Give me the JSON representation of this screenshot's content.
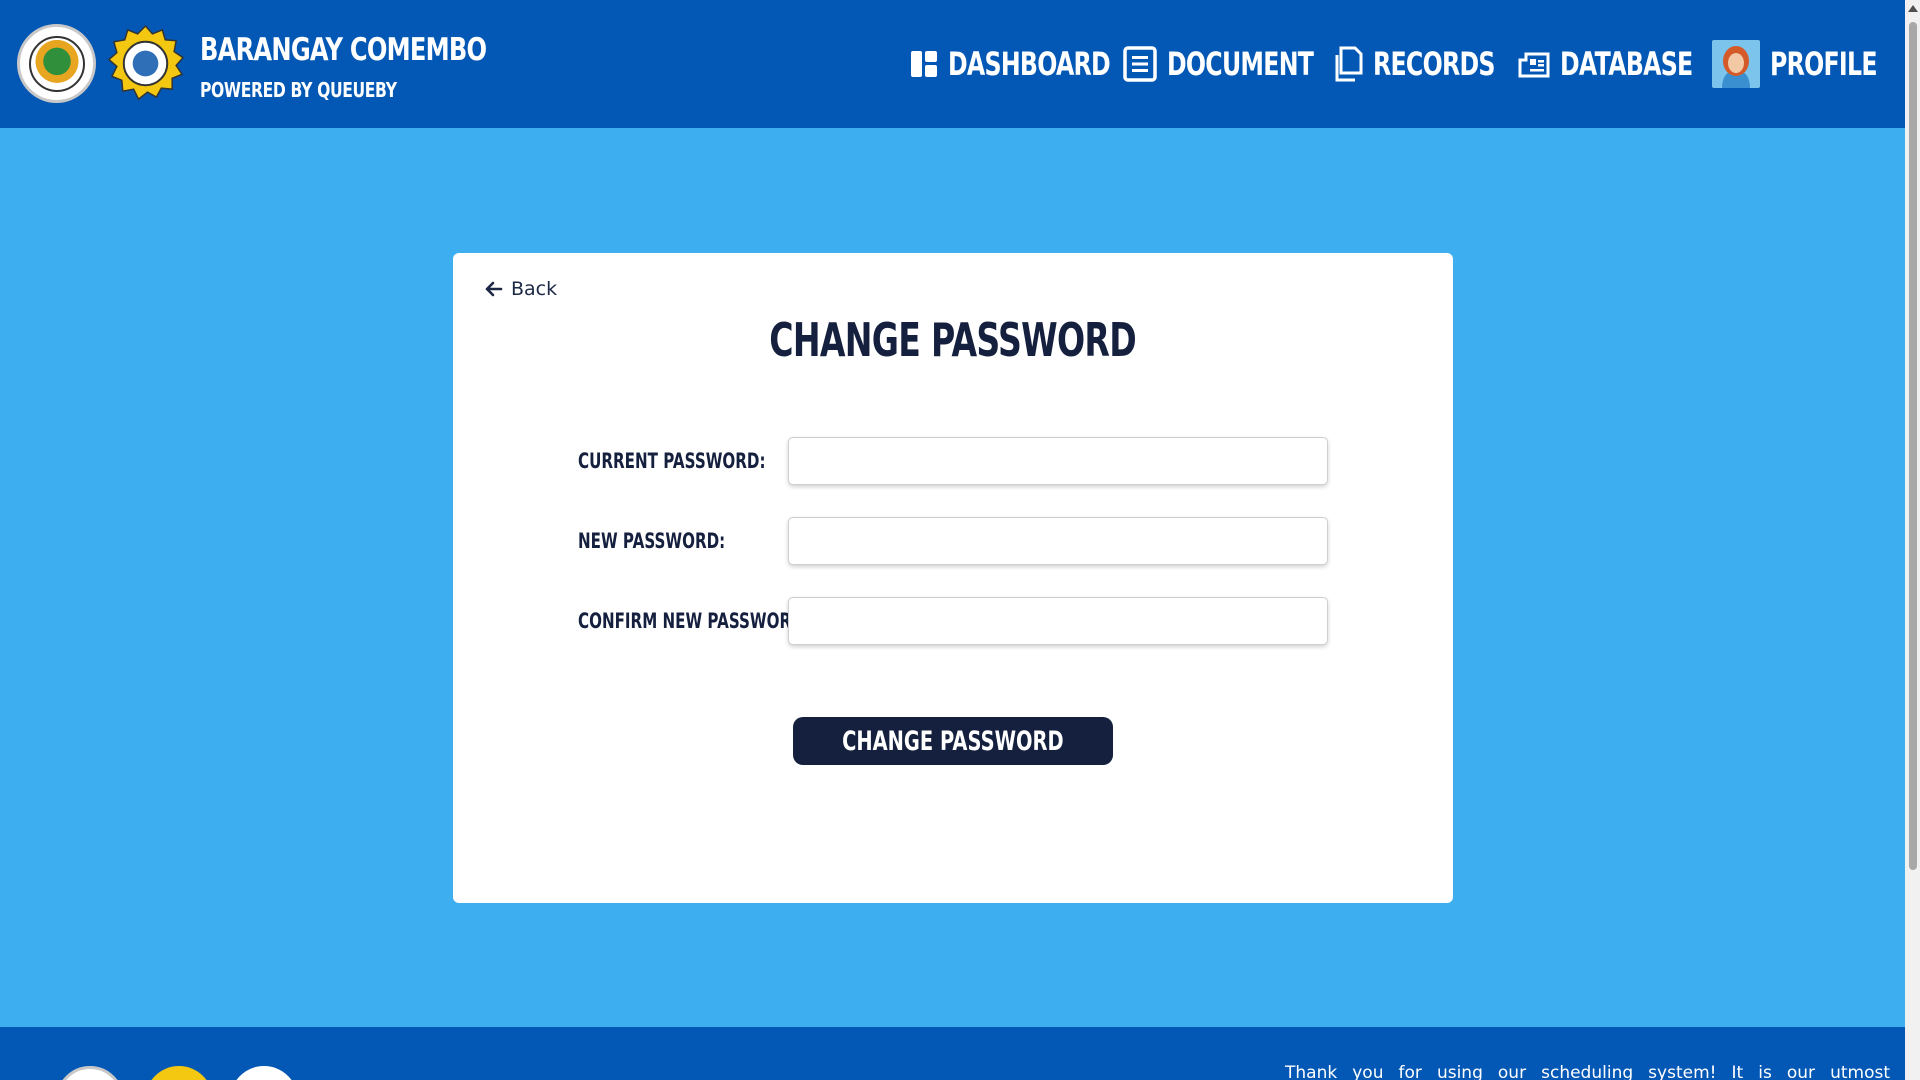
{
  "header": {
    "title": "BARANGAY COMEMBO",
    "subtitle": "POWERED BY QUEUEBY",
    "logos": [
      "lungsod-ng-makati-seal",
      "comembo-seal"
    ],
    "nav": [
      {
        "label": "DASHBOARD",
        "icon": "dashboard-icon"
      },
      {
        "label": "DOCUMENT",
        "icon": "document-icon"
      },
      {
        "label": "RECORDS",
        "icon": "records-icon"
      },
      {
        "label": "DATABASE",
        "icon": "database-icon"
      },
      {
        "label": "PROFILE",
        "icon": "avatar"
      }
    ]
  },
  "card": {
    "back_label": "Back",
    "title": "CHANGE PASSWORD",
    "fields": [
      {
        "label": "CURRENT PASSWORD:",
        "value": "",
        "placeholder": ""
      },
      {
        "label": "NEW PASSWORD:",
        "value": "",
        "placeholder": ""
      },
      {
        "label": "CONFIRM NEW PASSWORD:",
        "value": "",
        "placeholder": ""
      }
    ],
    "submit_label": "CHANGE PASSWORD"
  },
  "footer": {
    "text": "Thank you for using our scheduling system! It is our utmost"
  },
  "colors": {
    "header_bg": "#0458b5",
    "page_bg": "#3daef0",
    "card_bg": "#ffffff",
    "primary_dark": "#15203f",
    "logo_gold": "#f4c811"
  }
}
